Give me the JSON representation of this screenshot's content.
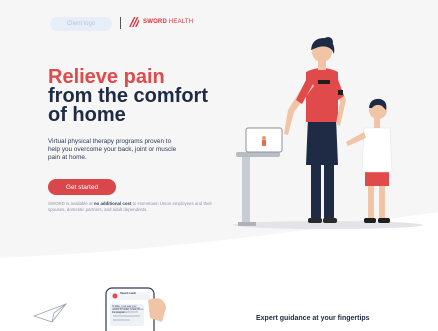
{
  "header": {
    "client_logo": "Client logo",
    "brand_name": "SWORD",
    "brand_suffix": " HEALTH"
  },
  "hero": {
    "headline_line1": "Relieve pain",
    "headline_line2": "from the comfort",
    "headline_line3": "of home",
    "subtext": "Virtual physical therapy programs proven to help you overcome your back, joint or muscle pain at home.",
    "cta_label": "Get started",
    "disclaimer_prefix": "SWORD is available at ",
    "disclaimer_bold": "no additional cost",
    "disclaimer_suffix": " to Hometown Union employees and their spouses, domestic partners, and adult dependents."
  },
  "chat_preview": {
    "sender": "Sword coach",
    "message": "Hi Mike, I just saw your results for today. Great job on the program..."
  },
  "section": {
    "title": "Expert guidance at your fingertips"
  },
  "colors": {
    "accent_red": "#e04a4a",
    "cta_red": "#d9474b",
    "navy": "#1f2a44",
    "hero_bg": "#f6f6f7"
  }
}
